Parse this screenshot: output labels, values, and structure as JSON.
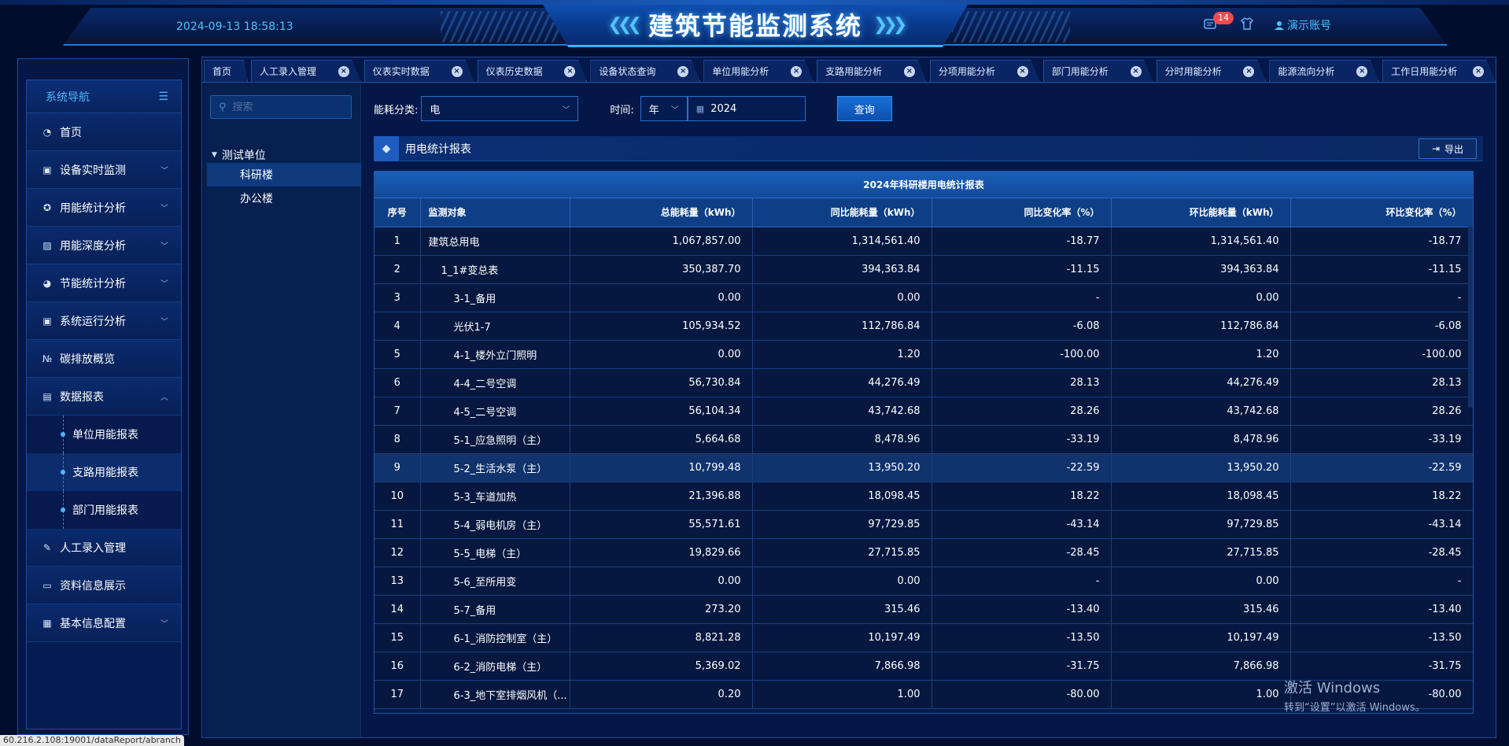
{
  "header": {
    "datetime": "2024-09-13 18:58:13",
    "title": "建筑节能监测系统",
    "badge_count": "14",
    "account": "演示账号"
  },
  "sidebar": {
    "title": "系统导航",
    "items": [
      {
        "label": "首页",
        "icon": "dashboard-icon"
      },
      {
        "label": "设备实时监测",
        "icon": "monitor-icon"
      },
      {
        "label": "用能统计分析",
        "icon": "gauge-icon"
      },
      {
        "label": "用能深度分析",
        "icon": "image-chart-icon"
      },
      {
        "label": "节能统计分析",
        "icon": "globe-icon"
      },
      {
        "label": "系统运行分析",
        "icon": "monitor-chart-icon"
      },
      {
        "label": "碳排放概览",
        "icon": "numbers-icon"
      },
      {
        "label": "数据报表",
        "icon": "report-icon"
      },
      {
        "label": "人工录入管理",
        "icon": "edit-icon"
      },
      {
        "label": "资料信息展示",
        "icon": "document-icon"
      },
      {
        "label": "基本信息配置",
        "icon": "settings-icon"
      }
    ],
    "sub_items": [
      {
        "label": "单位用能报表"
      },
      {
        "label": "支路用能报表"
      },
      {
        "label": "部门用能报表"
      }
    ]
  },
  "tabs": [
    {
      "label": "首页"
    },
    {
      "label": "人工录入管理"
    },
    {
      "label": "仪表实时数据"
    },
    {
      "label": "仪表历史数据"
    },
    {
      "label": "设备状态查询"
    },
    {
      "label": "单位用能分析"
    },
    {
      "label": "支路用能分析"
    },
    {
      "label": "分项用能分析"
    },
    {
      "label": "部门用能分析"
    },
    {
      "label": "分时用能分析"
    },
    {
      "label": "能源流向分析"
    },
    {
      "label": "工作日用能分析"
    }
  ],
  "tree": {
    "search_placeholder": "搜索",
    "root": "测试单位",
    "nodes": [
      {
        "label": "科研楼"
      },
      {
        "label": "办公楼"
      }
    ]
  },
  "filters": {
    "category_label": "能耗分类:",
    "category_value": "电",
    "time_label": "时间:",
    "period_value": "年",
    "year_value": "2024",
    "query_button": "查询"
  },
  "report": {
    "title": "用电统计报表",
    "export_button": "导出",
    "caption": "2024年科研楼用电统计报表",
    "columns": [
      "序号",
      "监测对象",
      "总能耗量（kWh）",
      "同比能耗量（kWh）",
      "同比变化率（%）",
      "环比能耗量（kWh）",
      "环比变化率（%）"
    ],
    "rows": [
      {
        "c0": "1",
        "c1": "建筑总用电",
        "c2": "1,067,857.00",
        "c3": "1,314,561.40",
        "c4": "-18.77",
        "c5": "1,314,561.40",
        "c6": "-18.77"
      },
      {
        "c0": "2",
        "c1": "1_1#变总表",
        "c2": "350,387.70",
        "c3": "394,363.84",
        "c4": "-11.15",
        "c5": "394,363.84",
        "c6": "-11.15"
      },
      {
        "c0": "3",
        "c1": "3-1_备用",
        "c2": "0.00",
        "c3": "0.00",
        "c4": "-",
        "c5": "0.00",
        "c6": "-"
      },
      {
        "c0": "4",
        "c1": "光伏1-7",
        "c2": "105,934.52",
        "c3": "112,786.84",
        "c4": "-6.08",
        "c5": "112,786.84",
        "c6": "-6.08"
      },
      {
        "c0": "5",
        "c1": "4-1_楼外立门照明",
        "c2": "0.00",
        "c3": "1.20",
        "c4": "-100.00",
        "c5": "1.20",
        "c6": "-100.00"
      },
      {
        "c0": "6",
        "c1": "4-4_二号空调",
        "c2": "56,730.84",
        "c3": "44,276.49",
        "c4": "28.13",
        "c5": "44,276.49",
        "c6": "28.13"
      },
      {
        "c0": "7",
        "c1": "4-5_二号空调",
        "c2": "56,104.34",
        "c3": "43,742.68",
        "c4": "28.26",
        "c5": "43,742.68",
        "c6": "28.26"
      },
      {
        "c0": "8",
        "c1": "5-1_应急照明（主）",
        "c2": "5,664.68",
        "c3": "8,478.96",
        "c4": "-33.19",
        "c5": "8,478.96",
        "c6": "-33.19"
      },
      {
        "c0": "9",
        "c1": "5-2_生活水泵（主）",
        "c2": "10,799.48",
        "c3": "13,950.20",
        "c4": "-22.59",
        "c5": "13,950.20",
        "c6": "-22.59"
      },
      {
        "c0": "10",
        "c1": "5-3_车道加热",
        "c2": "21,396.88",
        "c3": "18,098.45",
        "c4": "18.22",
        "c5": "18,098.45",
        "c6": "18.22"
      },
      {
        "c0": "11",
        "c1": "5-4_弱电机房（主）",
        "c2": "55,571.61",
        "c3": "97,729.85",
        "c4": "-43.14",
        "c5": "97,729.85",
        "c6": "-43.14"
      },
      {
        "c0": "12",
        "c1": "5-5_电梯（主）",
        "c2": "19,829.66",
        "c3": "27,715.85",
        "c4": "-28.45",
        "c5": "27,715.85",
        "c6": "-28.45"
      },
      {
        "c0": "13",
        "c1": "5-6_至所用变",
        "c2": "0.00",
        "c3": "0.00",
        "c4": "-",
        "c5": "0.00",
        "c6": "-"
      },
      {
        "c0": "14",
        "c1": "5-7_备用",
        "c2": "273.20",
        "c3": "315.46",
        "c4": "-13.40",
        "c5": "315.46",
        "c6": "-13.40"
      },
      {
        "c0": "15",
        "c1": "6-1_消防控制室（主）",
        "c2": "8,821.28",
        "c3": "10,197.49",
        "c4": "-13.50",
        "c5": "10,197.49",
        "c6": "-13.50"
      },
      {
        "c0": "16",
        "c1": "6-2_消防电梯（主）",
        "c2": "5,369.02",
        "c3": "7,866.98",
        "c4": "-31.75",
        "c5": "7,866.98",
        "c6": "-31.75"
      },
      {
        "c0": "17",
        "c1": "6-3_地下室排烟风机（...",
        "c2": "0.20",
        "c3": "1.00",
        "c4": "-80.00",
        "c5": "1.00",
        "c6": "-80.00"
      }
    ]
  },
  "watermark": {
    "line1": "激活 Windows",
    "line2": "转到“设置”以激活 Windows。"
  },
  "statusbar": "60.216.2.108:19001/dataReport/abranch"
}
